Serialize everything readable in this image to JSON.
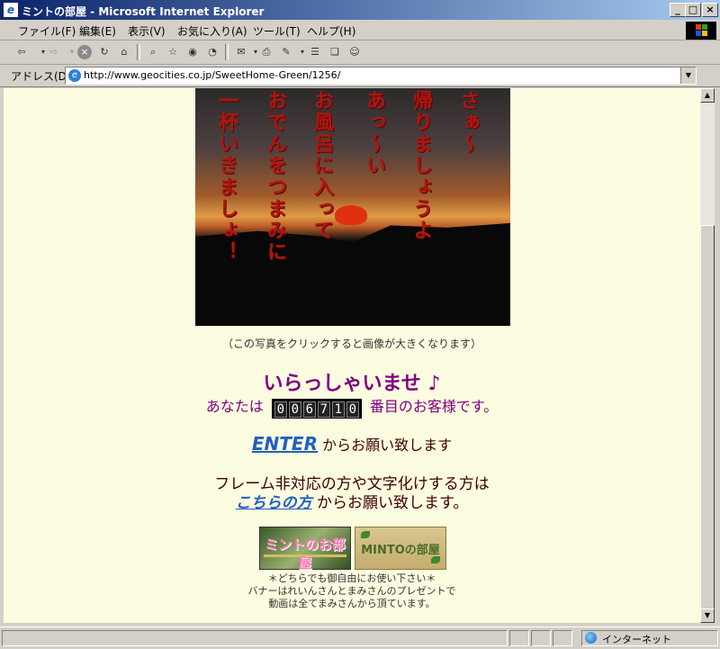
{
  "window": {
    "title": "ミントの部屋 - Microsoft Internet Explorer",
    "app_icon": "ie-icon"
  },
  "menu": [
    "ファイル(F)",
    "編集(E)",
    "表示(V)",
    "お気に入り(A)",
    "ツール(T)",
    "ヘルプ(H)"
  ],
  "address": {
    "label": "アドレス(D)",
    "url": "http://www.geocities.co.jp/SweetHome-Green/1256/"
  },
  "photo": {
    "poem_lines": [
      "さぁ～",
      "帰りましょうよ",
      "あっ～い",
      "お風呂に入って",
      "おでんをつまみに",
      "一杯いきましょ！"
    ],
    "caption": "（この写真をクリックすると画像が大きくなります）"
  },
  "welcome": {
    "greeting": "いらっしゃいませ ♪",
    "prefix": "あなたは",
    "counter": [
      "0",
      "0",
      "6",
      "7",
      "1",
      "0"
    ],
    "suffix": "番目のお客様です。"
  },
  "enter": {
    "link": "ENTER",
    "text": "からお願い致します"
  },
  "frame_note": {
    "line1": "フレーム非対応の方や文字化けする方は",
    "link": "こちらの方",
    "text": "からお願い致します。"
  },
  "banners": {
    "banner1": "ミントのお部屋",
    "banner2": "MINTOの部屋"
  },
  "notes": [
    "＊どちらでも御自由にお使い下さい＊",
    "バナーはれいんさんとまみさんのプレゼントで",
    "動画は全てまみさんから頂ています。"
  ],
  "status": {
    "zone": "インターネット"
  },
  "colors": {
    "title_gradient_start": "#0a246a",
    "page_background": "#fcfce0",
    "poem_red": "#b0150f",
    "purple": "#800080",
    "link_blue": "#2060c0"
  }
}
